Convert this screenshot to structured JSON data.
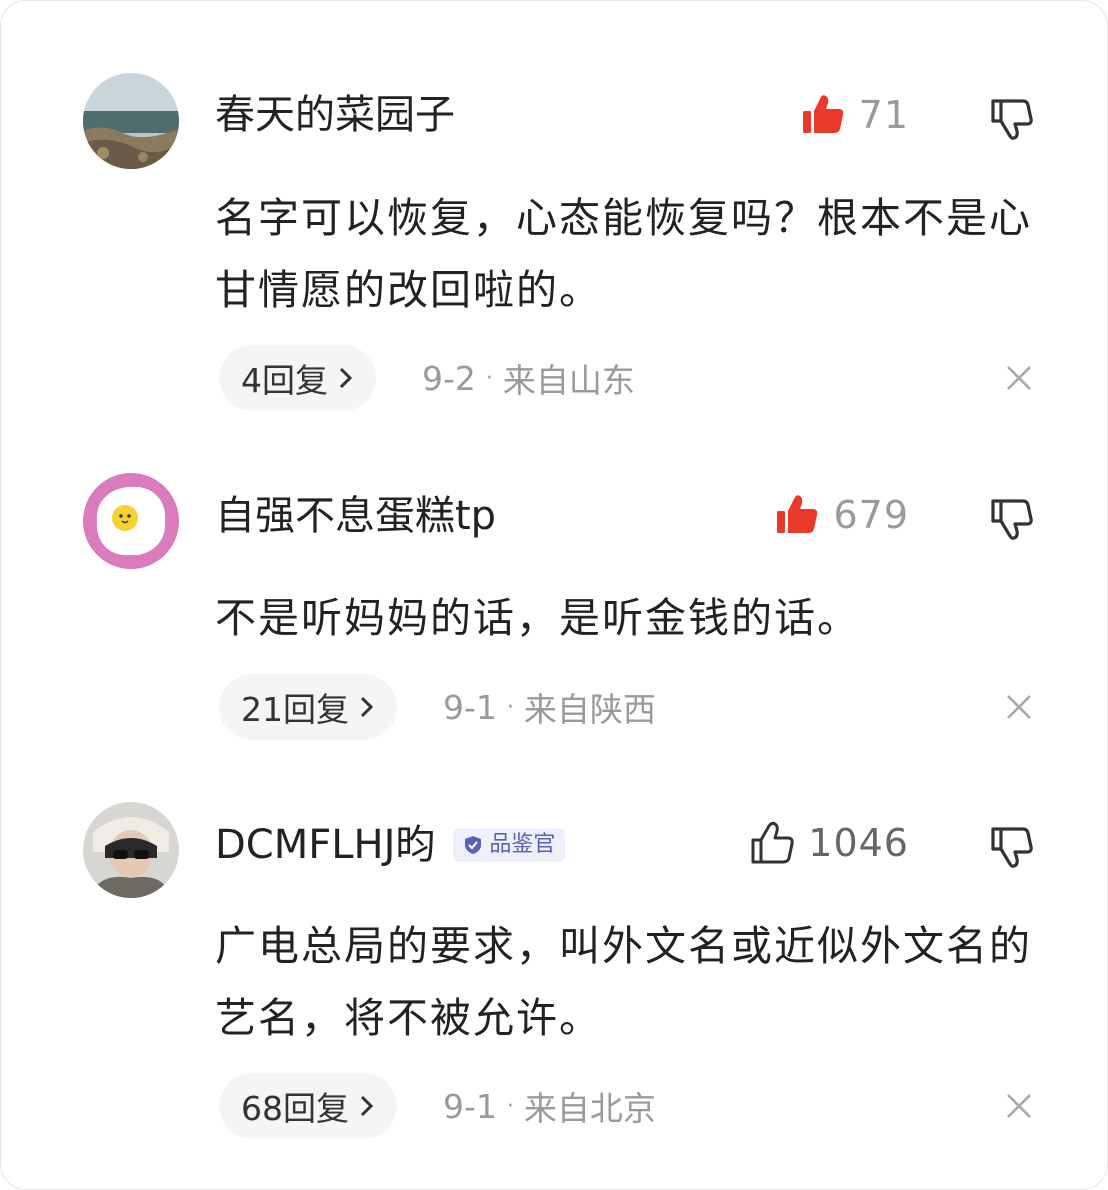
{
  "comments": [
    {
      "username": "春天的菜园子",
      "likes": "71",
      "liked": true,
      "text": "名字可以恢复，心态能恢复吗？根本不是心甘情愿的改回啦的。",
      "replies": "4回复",
      "date": "9-2",
      "location": "来自山东",
      "avatar_icon": "sea-landscape-avatar",
      "badge": ""
    },
    {
      "username": "自强不息蛋糕tp",
      "likes": "679",
      "liked": true,
      "text": "不是听妈妈的话，是听金钱的话。",
      "replies": "21回复",
      "date": "9-1",
      "location": "来自陕西",
      "avatar_icon": "fried-egg-avatar",
      "badge": ""
    },
    {
      "username": "DCMFLHJ昀",
      "likes": "1046",
      "liked": false,
      "text": "广电总局的要求，叫外文名或近似外文名的艺名，将不被允许。",
      "replies": "68回复",
      "date": "9-1",
      "location": "来自北京",
      "avatar_icon": "person-sunglasses-avatar",
      "badge": "品鉴官"
    }
  ],
  "separator": "·",
  "colors": {
    "like_active": "#e8392b",
    "text": "#222222",
    "meta": "#9a9a9a",
    "pill_bg": "#f4f5f7",
    "badge_bg": "#eef0fb",
    "badge_text": "#5a62b8"
  },
  "icons": {
    "like_active": "thumbs-up-filled-icon",
    "like_inactive": "thumbs-up-outline-icon",
    "dislike": "thumbs-down-outline-icon",
    "close": "close-icon",
    "chevron": "chevron-right-icon",
    "badge": "shield-check-icon"
  }
}
